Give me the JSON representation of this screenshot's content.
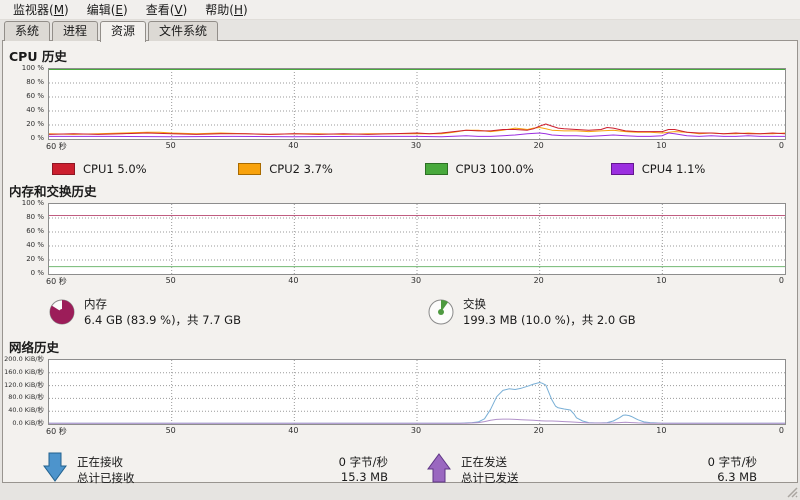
{
  "menu": {
    "items": [
      {
        "pre": "监视器(",
        "mnemonic": "M",
        "post": ")"
      },
      {
        "pre": "编辑(",
        "mnemonic": "E",
        "post": ")"
      },
      {
        "pre": "查看(",
        "mnemonic": "V",
        "post": ")"
      },
      {
        "pre": "帮助(",
        "mnemonic": "H",
        "post": ")"
      }
    ]
  },
  "tabs": {
    "items": [
      {
        "label": "系统"
      },
      {
        "label": "进程"
      },
      {
        "label": "资源"
      },
      {
        "label": "文件系统"
      }
    ],
    "active": "资源"
  },
  "cpu": {
    "title": "CPU 历史",
    "legend": [
      {
        "label": "CPU1 5.0%",
        "color": "#cc1f2e",
        "border": "#8e1623"
      },
      {
        "label": "CPU2 3.7%",
        "color": "#f8a20c",
        "border": "#a86a00"
      },
      {
        "label": "CPU3 100.0%",
        "color": "#48a93c",
        "border": "#2c6f24"
      },
      {
        "label": "CPU4 1.1%",
        "color": "#9b2fe0",
        "border": "#64168f"
      }
    ]
  },
  "memory": {
    "title": "内存和交换历史",
    "memory": {
      "label": "内存",
      "detail": "6.4 GB (83.9 %)，共 7.7 GB",
      "percent": 83.9,
      "color": "#9c1d59"
    },
    "swap": {
      "label": "交换",
      "detail": "199.3 MB (10.0 %)，共 2.0 GB",
      "percent": 10.0,
      "color": "#4e9a40"
    }
  },
  "network": {
    "title": "网络历史",
    "receiving": {
      "label": "正在接收",
      "rate": "0 字节/秒",
      "total_label": "总计已接收",
      "total": "15.3 MB",
      "arrow_color": "#4d94cc"
    },
    "sending": {
      "label": "正在发送",
      "rate": "0 字节/秒",
      "total_label": "总计已发送",
      "total": "6.3 MB",
      "arrow_color": "#9a68c0"
    }
  },
  "chart_data": {
    "cpu": {
      "type": "line",
      "title": "CPU 历史",
      "x_ticks": [
        "60 秒",
        "50",
        "40",
        "30",
        "20",
        "10",
        "0"
      ],
      "y_ticks": [
        "100 %",
        "80 %",
        "60 %",
        "40 %",
        "20 %",
        "0 %"
      ],
      "x_range": [
        60,
        0
      ],
      "y_range": [
        0,
        100
      ],
      "xlabel": "秒",
      "ylabel": "%",
      "grid": true,
      "series": [
        {
          "name": "CPU3",
          "color": "#48a93c",
          "points": [
            [
              60,
              100
            ],
            [
              0,
              100
            ]
          ]
        },
        {
          "name": "CPU2",
          "color": "#f8a20c",
          "points": [
            [
              60,
              7
            ],
            [
              58,
              6
            ],
            [
              56,
              7
            ],
            [
              54,
              8
            ],
            [
              52,
              9
            ],
            [
              51,
              9
            ],
            [
              50,
              8
            ],
            [
              48,
              7
            ],
            [
              46,
              8
            ],
            [
              44,
              7
            ],
            [
              42,
              6
            ],
            [
              40,
              7
            ],
            [
              38,
              7
            ],
            [
              36,
              6
            ],
            [
              34,
              7
            ],
            [
              32,
              7
            ],
            [
              30,
              7
            ],
            [
              28,
              7
            ],
            [
              27,
              9
            ],
            [
              26,
              12
            ],
            [
              25,
              12
            ],
            [
              24,
              10
            ],
            [
              23,
              12
            ],
            [
              22,
              15
            ],
            [
              21.5,
              14
            ],
            [
              21,
              13
            ],
            [
              20.5,
              15
            ],
            [
              20,
              16
            ],
            [
              19.5,
              14
            ],
            [
              19,
              12
            ],
            [
              18,
              11
            ],
            [
              17,
              11
            ],
            [
              16,
              10
            ],
            [
              15,
              11
            ],
            [
              14,
              12
            ],
            [
              13,
              10
            ],
            [
              12,
              9
            ],
            [
              11,
              9
            ],
            [
              10,
              8
            ],
            [
              9,
              10
            ],
            [
              8,
              9
            ],
            [
              7,
              7
            ],
            [
              6,
              8
            ],
            [
              5,
              7
            ],
            [
              4,
              7
            ],
            [
              3,
              8
            ],
            [
              2,
              7
            ],
            [
              1,
              7
            ],
            [
              0,
              8
            ]
          ]
        },
        {
          "name": "CPU1",
          "color": "#cc1f2e",
          "points": [
            [
              60,
              6
            ],
            [
              58,
              7
            ],
            [
              56,
              6
            ],
            [
              54,
              7
            ],
            [
              52,
              8
            ],
            [
              50,
              7
            ],
            [
              48,
              6
            ],
            [
              46,
              7
            ],
            [
              44,
              7
            ],
            [
              42,
              6
            ],
            [
              40,
              7
            ],
            [
              38,
              6
            ],
            [
              36,
              7
            ],
            [
              34,
              6
            ],
            [
              32,
              7
            ],
            [
              30,
              8
            ],
            [
              29,
              7
            ],
            [
              28,
              8
            ],
            [
              27,
              10
            ],
            [
              26,
              12
            ],
            [
              25,
              11
            ],
            [
              24,
              11
            ],
            [
              23,
              13
            ],
            [
              22,
              13
            ],
            [
              21,
              12
            ],
            [
              20.5,
              14
            ],
            [
              20,
              18
            ],
            [
              19.5,
              21
            ],
            [
              19,
              18
            ],
            [
              18.5,
              15
            ],
            [
              18,
              14
            ],
            [
              17,
              13
            ],
            [
              16,
              12
            ],
            [
              15,
              13
            ],
            [
              14.5,
              16
            ],
            [
              14,
              15
            ],
            [
              13,
              11
            ],
            [
              12,
              10
            ],
            [
              11,
              10
            ],
            [
              10,
              10
            ],
            [
              9.5,
              13
            ],
            [
              9,
              13
            ],
            [
              8.5,
              11
            ],
            [
              8,
              9
            ],
            [
              7,
              8
            ],
            [
              6,
              8
            ],
            [
              5,
              7
            ],
            [
              4,
              8
            ],
            [
              3,
              7
            ],
            [
              2,
              7
            ],
            [
              1,
              8
            ],
            [
              0,
              7
            ]
          ]
        },
        {
          "name": "CPU4",
          "color": "#9b2fe0",
          "points": [
            [
              60,
              3
            ],
            [
              55,
              3
            ],
            [
              50,
              2.5
            ],
            [
              45,
              3
            ],
            [
              40,
              2.5
            ],
            [
              35,
              3
            ],
            [
              30,
              3
            ],
            [
              28,
              2.5
            ],
            [
              26,
              4
            ],
            [
              25,
              3
            ],
            [
              24,
              3
            ],
            [
              23,
              4
            ],
            [
              22,
              5
            ],
            [
              21,
              7
            ],
            [
              20,
              8
            ],
            [
              19.5,
              7
            ],
            [
              19,
              5
            ],
            [
              18,
              4
            ],
            [
              17,
              4
            ],
            [
              16,
              3
            ],
            [
              15,
              4
            ],
            [
              14,
              5
            ],
            [
              13,
              4
            ],
            [
              12,
              3
            ],
            [
              11,
              3
            ],
            [
              10,
              4
            ],
            [
              9.5,
              8
            ],
            [
              9,
              7
            ],
            [
              8,
              4
            ],
            [
              7,
              3
            ],
            [
              6,
              4
            ],
            [
              5,
              3
            ],
            [
              4,
              3
            ],
            [
              3,
              4
            ],
            [
              2,
              3
            ],
            [
              1,
              3
            ],
            [
              0,
              3
            ]
          ]
        }
      ]
    },
    "memory": {
      "type": "line",
      "title": "内存和交换历史",
      "x_ticks": [
        "60 秒",
        "50",
        "40",
        "30",
        "20",
        "10",
        "0"
      ],
      "y_ticks": [
        "100 %",
        "80 %",
        "60 %",
        "40 %",
        "20 %",
        "0 %"
      ],
      "x_range": [
        60,
        0
      ],
      "y_range": [
        0,
        100
      ],
      "grid": true,
      "series": [
        {
          "name": "内存",
          "color": "#c05c80",
          "points": [
            [
              60,
              84
            ],
            [
              0,
              84
            ]
          ]
        },
        {
          "name": "交换",
          "color": "#72b872",
          "points": [
            [
              60,
              10
            ],
            [
              0,
              10
            ]
          ]
        }
      ]
    },
    "network": {
      "type": "line",
      "title": "网络历史",
      "x_ticks": [
        "60 秒",
        "50",
        "40",
        "30",
        "20",
        "10",
        "0"
      ],
      "y_ticks": [
        "200.0 KiB/秒",
        "160.0 KiB/秒",
        "120.0 KiB/秒",
        "80.0 KiB/秒",
        "40.0 KiB/秒",
        "0.0 KiB/秒"
      ],
      "x_range": [
        60,
        0
      ],
      "y_range": [
        0,
        200
      ],
      "grid": true,
      "series": [
        {
          "name": "正在接收",
          "color": "#79afd6",
          "points": [
            [
              60,
              1
            ],
            [
              50,
              1
            ],
            [
              40,
              1
            ],
            [
              32,
              1
            ],
            [
              30,
              1
            ],
            [
              28,
              1
            ],
            [
              26.5,
              1
            ],
            [
              26,
              2
            ],
            [
              25.5,
              3
            ],
            [
              25,
              5
            ],
            [
              24.5,
              15
            ],
            [
              24,
              45
            ],
            [
              23.5,
              85
            ],
            [
              23,
              105
            ],
            [
              22.5,
              110
            ],
            [
              22,
              108
            ],
            [
              21.5,
              112
            ],
            [
              21,
              118
            ],
            [
              20.5,
              125
            ],
            [
              20,
              130
            ],
            [
              19.8,
              128
            ],
            [
              19.5,
              122
            ],
            [
              19,
              75
            ],
            [
              18.7,
              55
            ],
            [
              18.5,
              50
            ],
            [
              18,
              46
            ],
            [
              17.5,
              43
            ],
            [
              17.2,
              30
            ],
            [
              17,
              18
            ],
            [
              16.5,
              8
            ],
            [
              16,
              3
            ],
            [
              15.5,
              2
            ],
            [
              15,
              2
            ],
            [
              14.5,
              3
            ],
            [
              14,
              8
            ],
            [
              13.5,
              18
            ],
            [
              13.2,
              26
            ],
            [
              13,
              27
            ],
            [
              12.7,
              25
            ],
            [
              12.5,
              22
            ],
            [
              12,
              12
            ],
            [
              11.5,
              5
            ],
            [
              11,
              3
            ],
            [
              10.5,
              2
            ],
            [
              10,
              1
            ],
            [
              8,
              1
            ],
            [
              6,
              1
            ],
            [
              4,
              1
            ],
            [
              2,
              1
            ],
            [
              0,
              1
            ]
          ]
        },
        {
          "name": "正在发送",
          "color": "#b191c9",
          "points": [
            [
              60,
              0.5
            ],
            [
              40,
              0.5
            ],
            [
              30,
              0.5
            ],
            [
              27,
              0.5
            ],
            [
              26,
              1
            ],
            [
              25,
              3
            ],
            [
              24.5,
              6
            ],
            [
              24,
              10
            ],
            [
              23.5,
              13
            ],
            [
              23,
              14
            ],
            [
              22.5,
              14
            ],
            [
              22,
              13
            ],
            [
              21.5,
              12
            ],
            [
              21,
              11
            ],
            [
              20.5,
              10
            ],
            [
              20,
              9
            ],
            [
              19.5,
              8
            ],
            [
              19,
              8
            ],
            [
              18.5,
              7
            ],
            [
              18,
              6
            ],
            [
              17.5,
              5
            ],
            [
              17,
              4
            ],
            [
              16.5,
              3
            ],
            [
              16,
              2
            ],
            [
              15,
              1.5
            ],
            [
              14,
              2
            ],
            [
              13.5,
              3
            ],
            [
              13,
              4
            ],
            [
              12.5,
              3
            ],
            [
              12,
              2
            ],
            [
              11,
              1
            ],
            [
              10,
              0.5
            ],
            [
              8,
              0.5
            ],
            [
              6,
              0.5
            ],
            [
              4,
              0.5
            ],
            [
              2,
              0.5
            ],
            [
              0,
              0.5
            ]
          ]
        }
      ]
    }
  }
}
